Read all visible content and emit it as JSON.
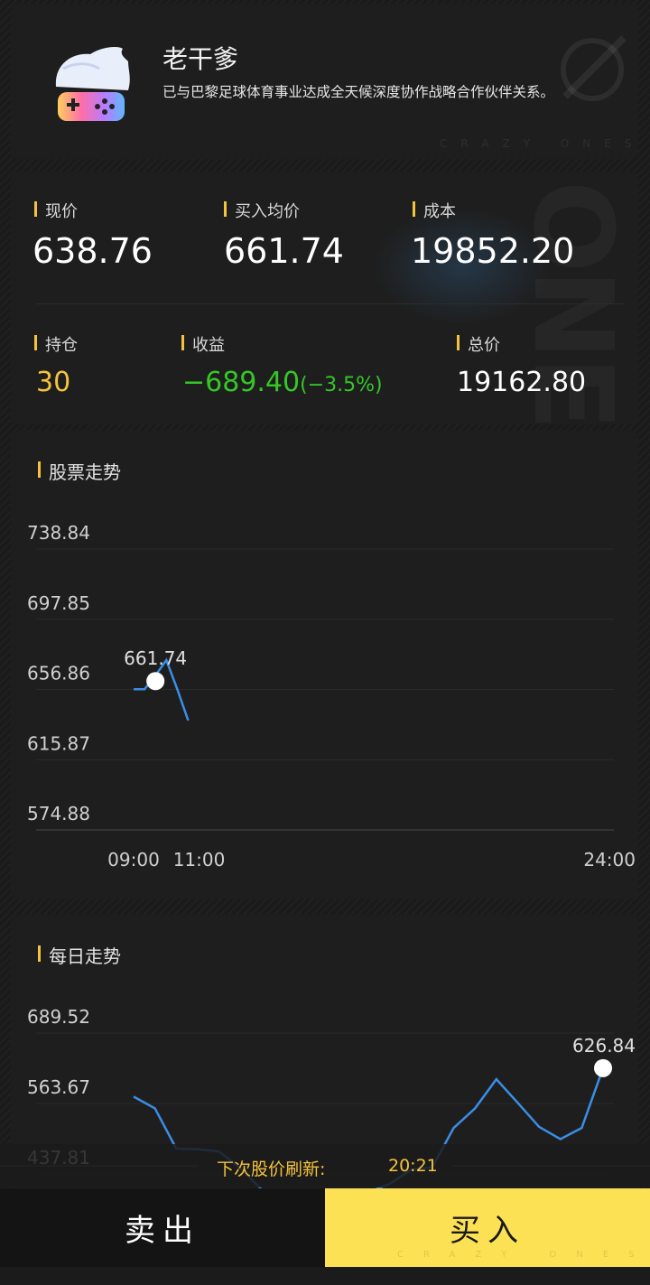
{
  "header": {
    "title": "老干爹",
    "description": "已与巴黎足球体育事业达成全天候深度协作战略合作伙伴关系。",
    "watermark": "CRAZY ONES"
  },
  "stats": {
    "current_price": {
      "label": "现价",
      "value": "638.76"
    },
    "avg_buy_price": {
      "label": "买入均价",
      "value": "661.74"
    },
    "cost": {
      "label": "成本",
      "value": "19852.20"
    },
    "holding": {
      "label": "持仓",
      "value": "30"
    },
    "profit": {
      "label": "收益",
      "value": "−689.40",
      "percent": "(−3.5%)"
    },
    "total": {
      "label": "总价",
      "value": "19162.80"
    }
  },
  "intraday_chart": {
    "title": "股票走势",
    "marker_label": "661.74"
  },
  "daily_chart": {
    "title": "每日走势",
    "marker_label": "626.84"
  },
  "chart_data": [
    {
      "type": "line",
      "title": "股票走势",
      "y_ticks": [
        "738.84",
        "697.85",
        "656.86",
        "615.87",
        "574.88"
      ],
      "ylim": [
        574.88,
        738.84
      ],
      "x_ticks": [
        "09:00",
        "11:00",
        "24:00"
      ],
      "series": [
        {
          "values": [
            {
              "x": "09:00",
              "y": 657
            },
            {
              "x": "09:10",
              "y": 657
            },
            {
              "x": "09:20",
              "y": 657
            },
            {
              "x": "09:40",
              "y": 665
            },
            {
              "x": "10:00",
              "y": 674
            },
            {
              "x": "10:20",
              "y": 657
            },
            {
              "x": "10:40",
              "y": 638.76
            }
          ]
        }
      ],
      "highlight": {
        "x": "09:40",
        "y": 661.74,
        "label": "661.74"
      },
      "color": "#3a8ee6"
    },
    {
      "type": "line",
      "title": "每日走势",
      "y_ticks": [
        "689.52",
        "563.67",
        "437.81"
      ],
      "ylim": [
        311.95,
        689.52
      ],
      "series": [
        {
          "values": [
            576,
            555,
            483,
            482,
            478,
            448,
            410,
            395,
            392,
            390,
            392,
            405,
            420,
            445,
            450,
            520,
            555,
            607,
            565,
            522,
            500,
            520,
            626.84
          ]
        }
      ],
      "highlight": {
        "label": "626.84",
        "y": 626.84
      },
      "color": "#3a8ee6"
    }
  ],
  "refresh": {
    "label": "下次股价刷新:",
    "time": "20:21"
  },
  "actions": {
    "sell": "卖出",
    "buy": "买入"
  },
  "colors": {
    "accent": "#f5c33b",
    "profit_negative": "#34c726",
    "buy_button": "#fde154",
    "line": "#3a8ee6"
  }
}
